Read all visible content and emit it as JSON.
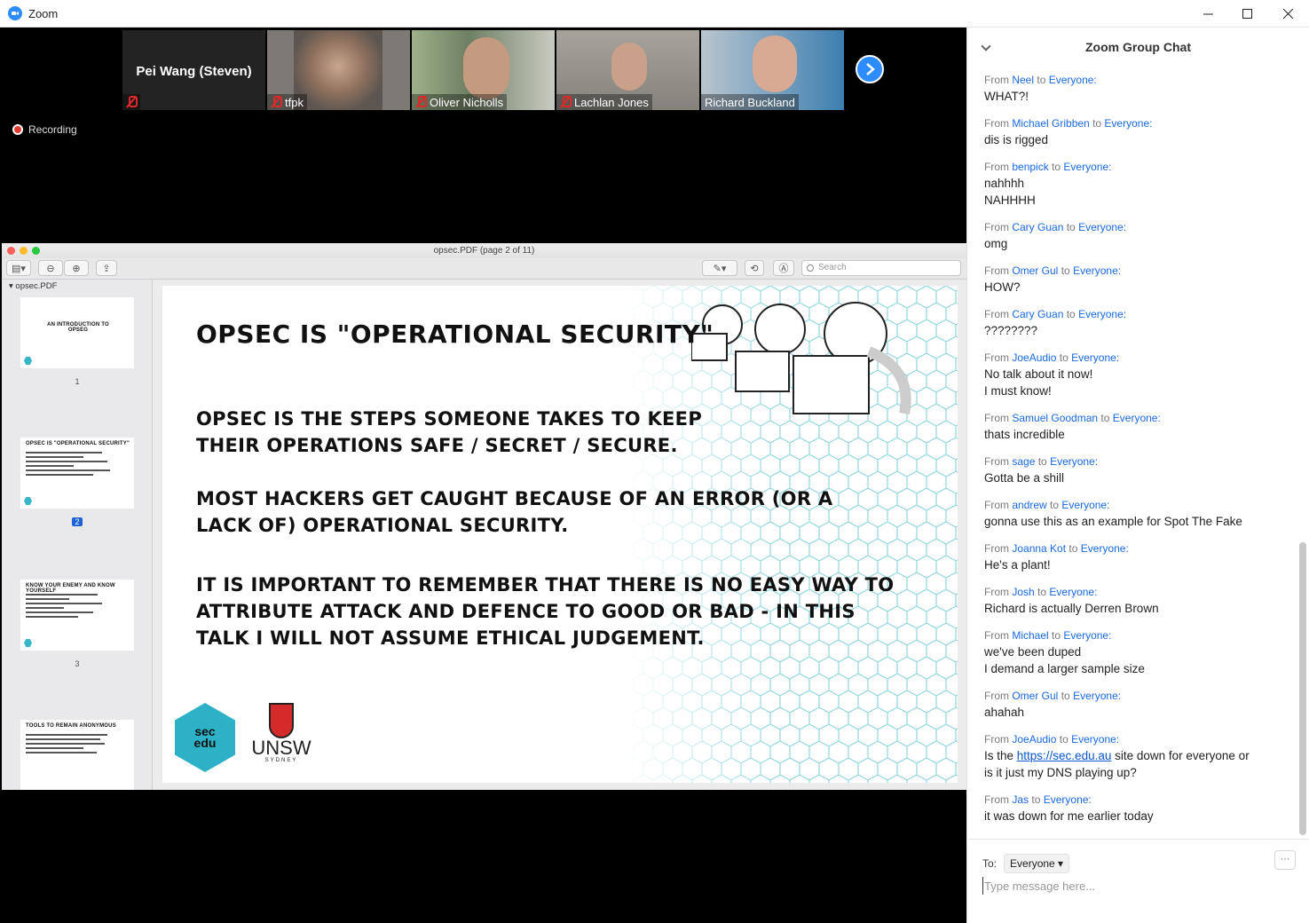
{
  "window": {
    "title": "Zoom"
  },
  "participants": [
    {
      "name": "Pei Wang (Steven)",
      "video": false,
      "bg": "#232323"
    },
    {
      "name": "tfpk",
      "video": true,
      "bg": "#7d7a76"
    },
    {
      "name": "Oliver Nicholls",
      "video": true,
      "bg": "#8a9a78"
    },
    {
      "name": "Lachlan Jones",
      "video": true,
      "bg": "#8f8c86"
    },
    {
      "name": "Richard Buckland",
      "video": true,
      "bg": "#7fa0b6"
    }
  ],
  "recording": {
    "label": "Recording"
  },
  "preview": {
    "window_title": "opsec.PDF (page 2 of 11)",
    "sidebar_file": "opsec.PDF",
    "search_placeholder": "Search",
    "thumbnails": [
      {
        "page": "1",
        "title": "AN INTRODUCTION TO OPSEG",
        "selected": false
      },
      {
        "page": "2",
        "title": "OPSEC IS \"OPERATIONAL SECURITY\"",
        "selected": true
      },
      {
        "page": "3",
        "title": "KNOW YOUR ENEMY AND KNOW YOURSELF",
        "selected": false
      },
      {
        "page": "",
        "title": "TOOLS TO REMAIN ANONYMOUS",
        "selected": false
      }
    ],
    "slide": {
      "title": "OPSEC IS \"OPERATIONAL SECURITY\"",
      "p1": "OPSEC IS THE STEPS SOMEONE TAKES TO KEEP THEIR OPERATIONS SAFE / SECRET / SECURE.",
      "p2": "MOST HACKERS GET CAUGHT BECAUSE OF AN ERROR (OR A LACK OF) OPERATIONAL SECURITY.",
      "p3": "IT IS IMPORTANT TO REMEMBER THAT THERE IS NO EASY WAY TO ATTRIBUTE ATTACK AND DEFENCE TO GOOD OR BAD - IN THIS TALK I WILL NOT ASSUME ETHICAL JUDGEMENT.",
      "logo_left": "sec\nedu",
      "logo_right": "UNSW",
      "logo_right_sub": "SYDNEY"
    }
  },
  "chat": {
    "title": "Zoom Group Chat",
    "from_word": "From",
    "to_word": "to",
    "messages": [
      {
        "sender": "Neel",
        "to": "Everyone:",
        "lines": [
          "WHAT?!"
        ]
      },
      {
        "sender": "Michael Gribben",
        "to": "Everyone:",
        "lines": [
          "dis is rigged"
        ]
      },
      {
        "sender": "benpick",
        "to": "Everyone:",
        "lines": [
          "nahhhh",
          "NAHHHH"
        ]
      },
      {
        "sender": "Cary Guan",
        "to": "Everyone:",
        "lines": [
          "omg"
        ]
      },
      {
        "sender": "Omer Gul",
        "to": "Everyone:",
        "lines": [
          "HOW?"
        ]
      },
      {
        "sender": "Cary Guan",
        "to": "Everyone:",
        "lines": [
          "????????"
        ]
      },
      {
        "sender": "JoeAudio",
        "to": "Everyone:",
        "lines": [
          "No talk about it now!",
          "I must know!"
        ]
      },
      {
        "sender": "Samuel Goodman",
        "to": "Everyone:",
        "lines": [
          "thats incredible"
        ]
      },
      {
        "sender": "sage",
        "to": "Everyone:",
        "lines": [
          "Gotta be a shill"
        ]
      },
      {
        "sender": "andrew",
        "to": "Everyone:",
        "lines": [
          "gonna use this as an example for Spot The Fake"
        ]
      },
      {
        "sender": "Joanna Kot",
        "to": "Everyone:",
        "lines": [
          "He's a plant!"
        ]
      },
      {
        "sender": "Josh",
        "to": "Everyone:",
        "lines": [
          "Richard is actually Derren Brown"
        ]
      },
      {
        "sender": "Michael",
        "to": "Everyone:",
        "lines": [
          "we've been duped",
          "I demand a larger sample size"
        ]
      },
      {
        "sender": "Omer Gul",
        "to": "Everyone:",
        "lines": [
          "ahahah"
        ]
      },
      {
        "sender": "JoeAudio",
        "to": "Everyone:",
        "lines": [
          "Is the ",
          "https://sec.edu.au",
          " site down for everyone or",
          "is it just my DNS playing up?"
        ],
        "link": true
      },
      {
        "sender": "Jas",
        "to": "Everyone:",
        "lines": [
          "it was down for me earlier today"
        ]
      }
    ],
    "to_label": "To:",
    "recipient": "Everyone",
    "more_label": "···",
    "input_placeholder": "Type message here..."
  },
  "colors": {
    "accent": "#2d8cff",
    "link": "#1a6ae0",
    "stage": "#000000"
  }
}
